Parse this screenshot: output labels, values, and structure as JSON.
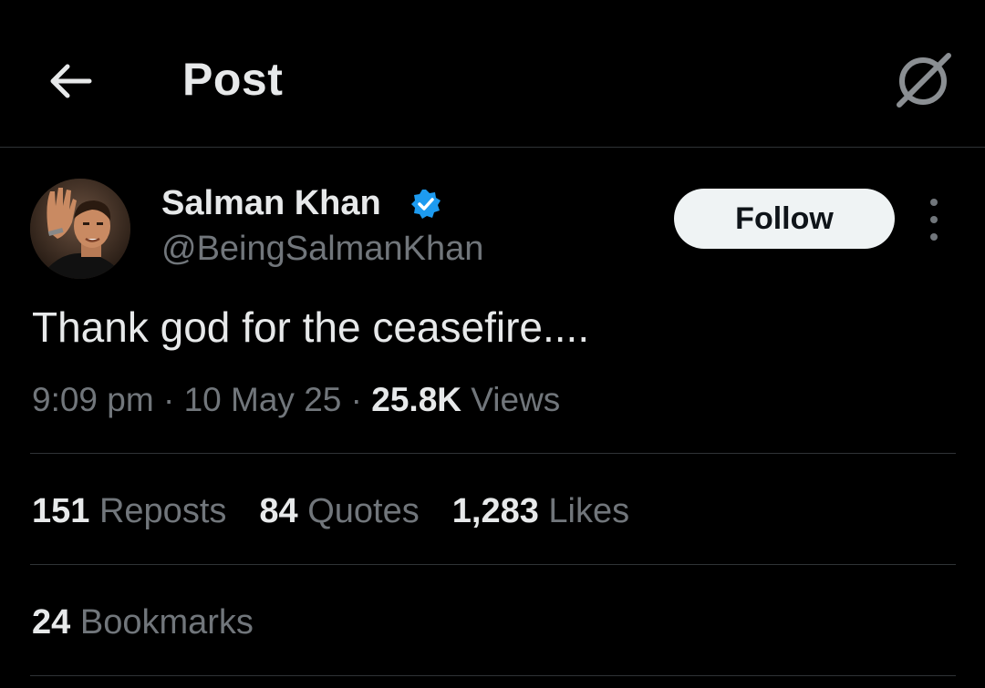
{
  "header": {
    "title": "Post",
    "back_icon": "arrow-left-icon",
    "grok_icon": "grok-slash-circle-icon"
  },
  "author": {
    "display_name": "Salman Khan",
    "handle": "@BeingSalmanKhan",
    "verified": true,
    "verified_color": "#1d9bf0",
    "follow_label": "Follow"
  },
  "post": {
    "text": "Thank god for the ceasefire....",
    "time": "9:09 pm",
    "date": "10 May 25",
    "views_count": "25.8K",
    "views_label": "Views",
    "separator": "·"
  },
  "stats": {
    "reposts_count": "151",
    "reposts_label": "Reposts",
    "quotes_count": "84",
    "quotes_label": "Quotes",
    "likes_count": "1,283",
    "likes_label": "Likes",
    "bookmarks_count": "24",
    "bookmarks_label": "Bookmarks"
  },
  "colors": {
    "background": "#000000",
    "primary_text": "#e7e9ea",
    "secondary_text": "#71767b",
    "divider": "#2f3336",
    "follow_bg": "#eff3f4"
  }
}
